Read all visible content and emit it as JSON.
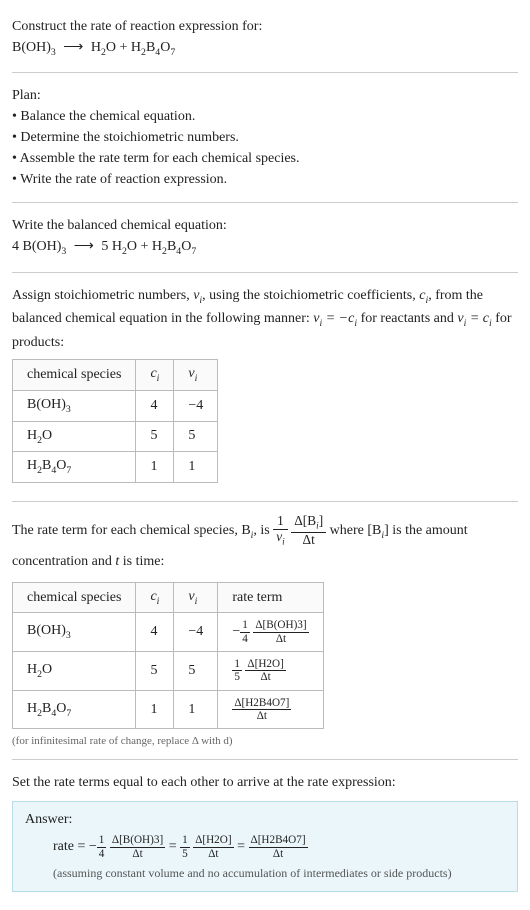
{
  "prompt": {
    "title": "Construct the rate of reaction expression for:",
    "eq_lhs": "B(OH)",
    "eq_lhs_sub": "3",
    "eq_rhs1": "H",
    "eq_rhs1_sub": "2",
    "eq_rhs1_b": "O + H",
    "eq_rhs1_b_sub": "2",
    "eq_rhs1_c": "B",
    "eq_rhs1_c_sub": "4",
    "eq_rhs1_d": "O",
    "eq_rhs1_d_sub": "7"
  },
  "plan": {
    "heading": "Plan:",
    "b1": "• Balance the chemical equation.",
    "b2": "• Determine the stoichiometric numbers.",
    "b3": "• Assemble the rate term for each chemical species.",
    "b4": "• Write the rate of reaction expression."
  },
  "balanced": {
    "heading": "Write the balanced chemical equation:",
    "coef1": "4 B(OH)",
    "sub1": "3",
    "coef2": "5 H",
    "sub2": "2",
    "tail": "O + H",
    "sub3": "2",
    "b": "B",
    "sub4": "4",
    "o": "O",
    "sub5": "7"
  },
  "assign": {
    "text1": "Assign stoichiometric numbers, ",
    "nu": "ν",
    "sub_i": "i",
    "text2": ", using the stoichiometric coefficients, ",
    "c": "c",
    "text3": ", from the balanced chemical equation in the following manner: ",
    "eq1": "ν",
    "eq1b": " = −c",
    "text4": " for reactants and ",
    "eq2": "ν",
    "eq2b": " = c",
    "text5": " for products:",
    "table": {
      "h1": "chemical species",
      "h2": "c",
      "h3": "ν",
      "rows": [
        {
          "sp": "B(OH)",
          "sp_sub": "3",
          "c": "4",
          "nu": "−4"
        },
        {
          "sp": "H",
          "sp_sub": "2",
          "sp_tail": "O",
          "c": "5",
          "nu": "5"
        },
        {
          "sp": "H",
          "sp_sub": "2",
          "sp_b": "B",
          "sp_sub2": "4",
          "sp_c": "O",
          "sp_sub3": "7",
          "c": "1",
          "nu": "1"
        }
      ]
    }
  },
  "rateterm": {
    "text1": "The rate term for each chemical species, B",
    "text2": ", is ",
    "frac1_num": "1",
    "frac1_den_a": "ν",
    "frac2_num_a": "Δ[B",
    "frac2_num_b": "]",
    "frac2_den": "Δt",
    "text3": " where [B",
    "text4": "] is the amount concentration and ",
    "t": "t",
    "text5": " is time:",
    "table": {
      "h1": "chemical species",
      "h2": "c",
      "h3": "ν",
      "h4": "rate term",
      "rows": [
        {
          "sp": "B(OH)",
          "sp_sub": "3",
          "c": "4",
          "nu": "−4",
          "neg": "−",
          "fa_num": "1",
          "fa_den": "4",
          "fb_num": "Δ[B(OH)3]",
          "fb_den": "Δt"
        },
        {
          "sp": "H",
          "sp_sub": "2",
          "sp_tail": "O",
          "c": "5",
          "nu": "5",
          "fa_num": "1",
          "fa_den": "5",
          "fb_num": "Δ[H2O]",
          "fb_den": "Δt"
        },
        {
          "sp": "H",
          "sp_sub": "2",
          "sp_b": "B",
          "sp_sub2": "4",
          "sp_c": "O",
          "sp_sub3": "7",
          "c": "1",
          "nu": "1",
          "fb_num": "Δ[H2B4O7]",
          "fb_den": "Δt"
        }
      ]
    },
    "footnote": "(for infinitesimal rate of change, replace Δ with d)"
  },
  "final": {
    "heading": "Set the rate terms equal to each other to arrive at the rate expression:",
    "ans_label": "Answer:",
    "rate_lhs": "rate = −",
    "f1_num": "1",
    "f1_den": "4",
    "f1b_num": "Δ[B(OH)3]",
    "f1b_den": "Δt",
    "eq": " = ",
    "f2_num": "1",
    "f2_den": "5",
    "f2b_num": "Δ[H2O]",
    "f2b_den": "Δt",
    "f3_num": "Δ[H2B4O7]",
    "f3_den": "Δt",
    "note": "(assuming constant volume and no accumulation of intermediates or side products)"
  },
  "arrow": "⟶"
}
